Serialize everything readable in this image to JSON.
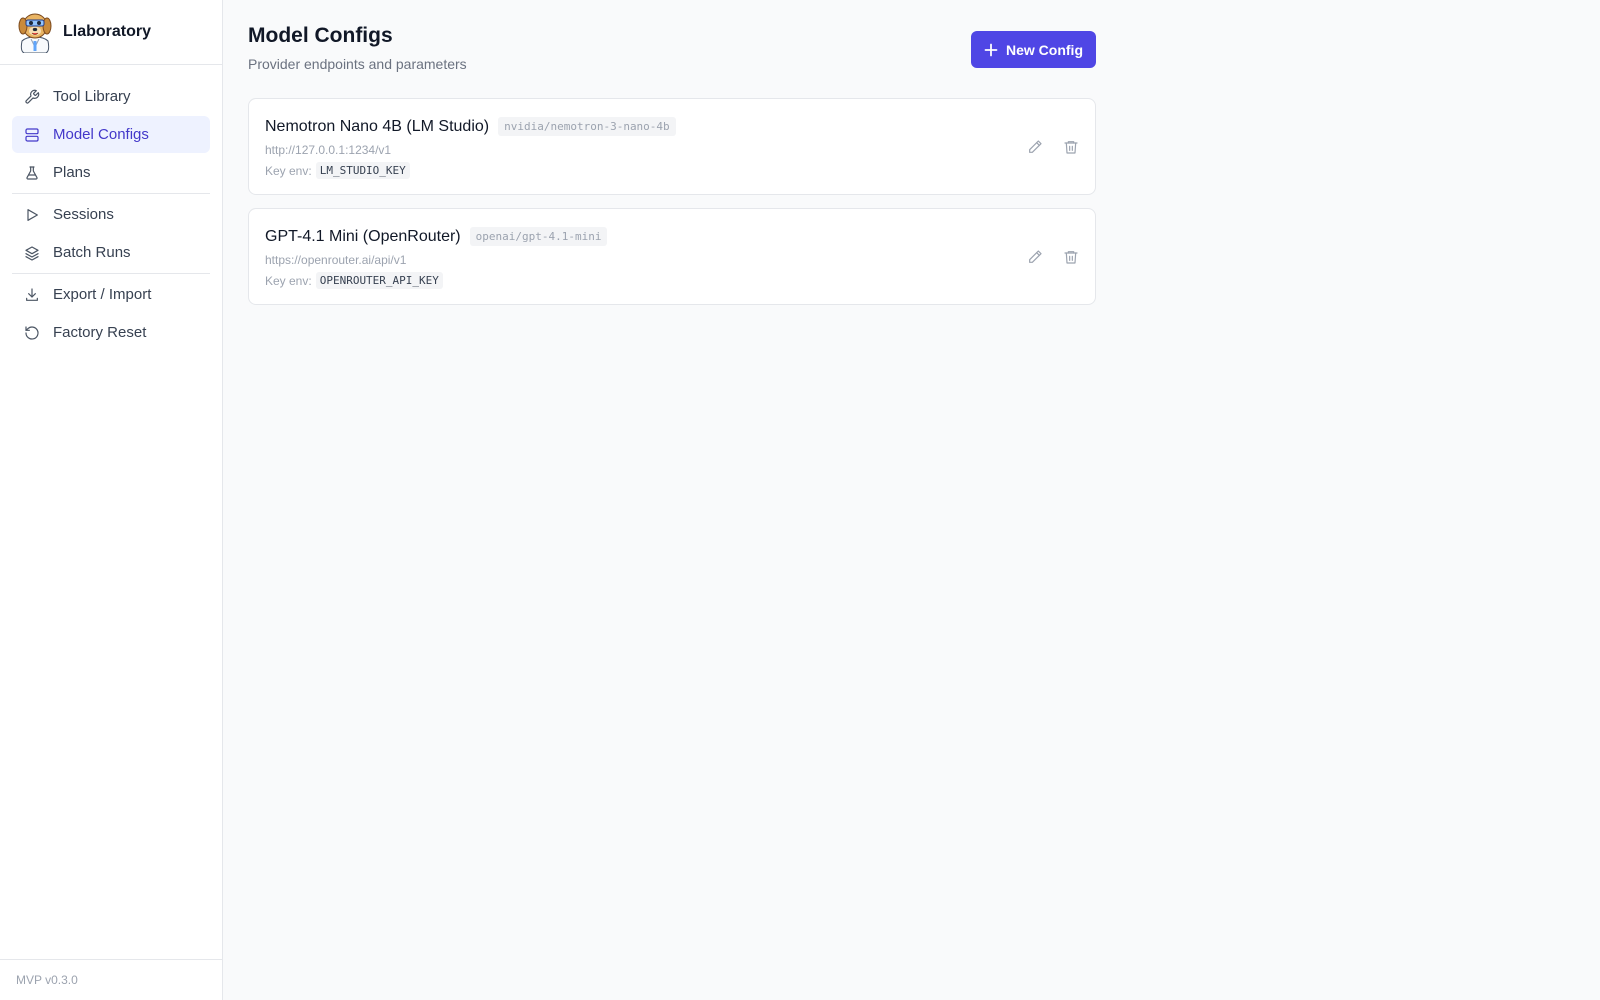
{
  "app": {
    "name": "Llaboratory",
    "version": "MVP v0.3.0"
  },
  "sidebar": {
    "items": [
      {
        "label": "Tool Library",
        "icon": "wrench-icon",
        "active": false
      },
      {
        "label": "Model Configs",
        "icon": "server-icon",
        "active": true
      },
      {
        "label": "Plans",
        "icon": "flask-icon",
        "active": false
      },
      {
        "label": "Sessions",
        "icon": "play-icon",
        "active": false
      },
      {
        "label": "Batch Runs",
        "icon": "layers-icon",
        "active": false
      },
      {
        "label": "Export / Import",
        "icon": "download-icon",
        "active": false
      },
      {
        "label": "Factory Reset",
        "icon": "reset-icon",
        "active": false
      }
    ]
  },
  "page": {
    "title": "Model Configs",
    "subtitle": "Provider endpoints and parameters",
    "new_button_label": "New Config"
  },
  "configs": [
    {
      "name": "Nemotron Nano 4B (LM Studio)",
      "model": "nvidia/nemotron-3-nano-4b",
      "url": "http://127.0.0.1:1234/v1",
      "key_label": "Key env:",
      "key_env": "LM_STUDIO_KEY"
    },
    {
      "name": "GPT-4.1 Mini (OpenRouter)",
      "model": "openai/gpt-4.1-mini",
      "url": "https://openrouter.ai/api/v1",
      "key_label": "Key env:",
      "key_env": "OPENROUTER_API_KEY"
    }
  ],
  "colors": {
    "accent": "#4f46e5",
    "active_bg": "#eef2ff",
    "active_text": "#4338ca"
  }
}
